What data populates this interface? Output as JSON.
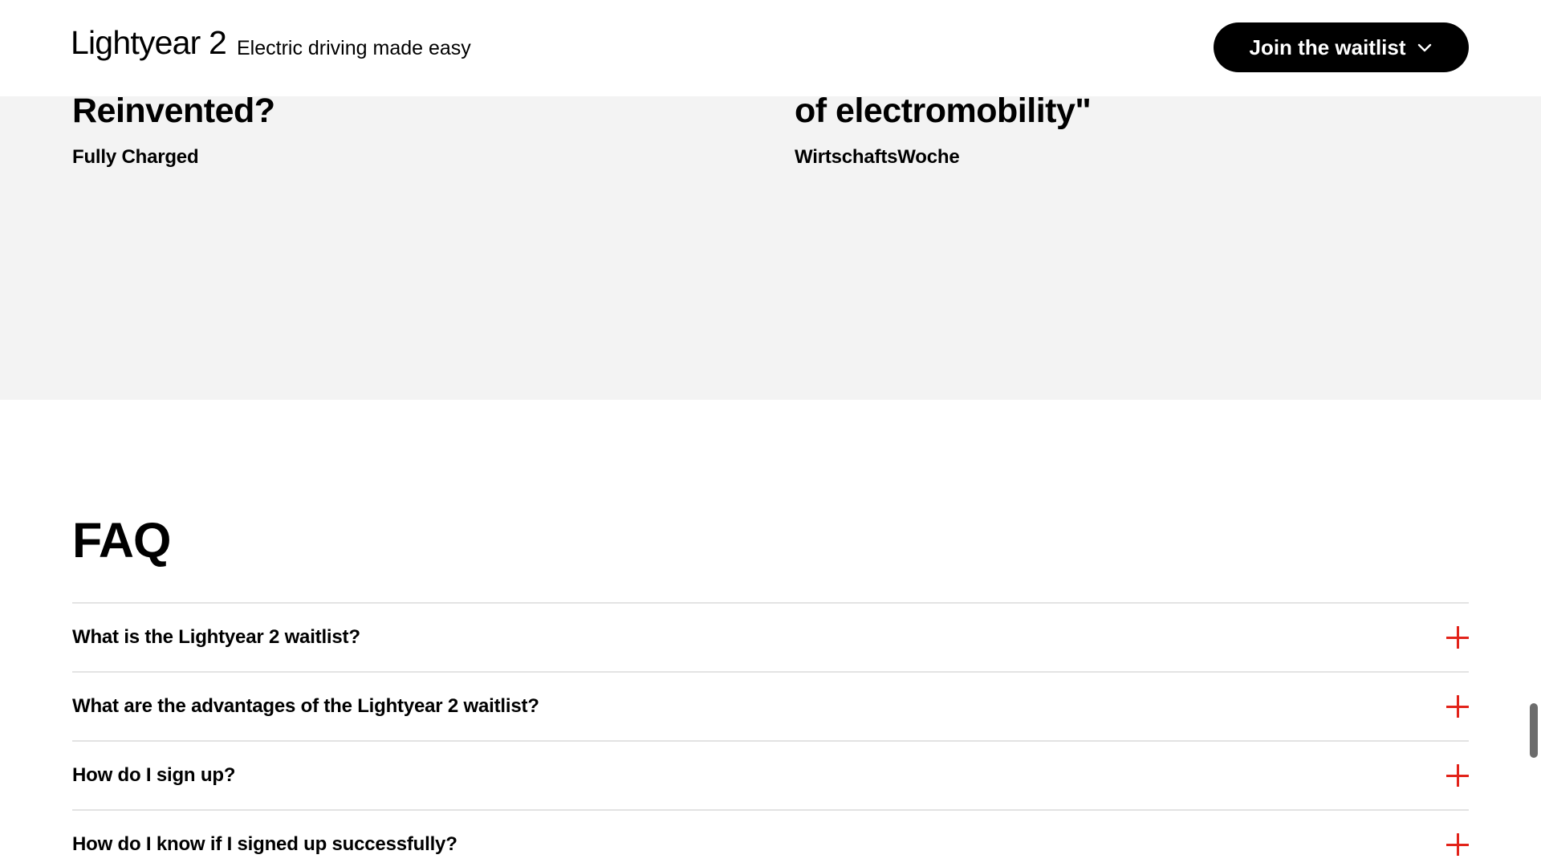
{
  "header": {
    "brand": "Lightyear 2",
    "tagline": "Electric driving made easy",
    "cta_label": "Join the waitlist"
  },
  "press": {
    "quotes": [
      {
        "title": "Reinvented?",
        "source": "Fully Charged"
      },
      {
        "title": "of electromobility\"",
        "source": "WirtschaftsWoche"
      }
    ]
  },
  "faq": {
    "title": "FAQ",
    "items": [
      {
        "question": "What is the Lightyear 2 waitlist?"
      },
      {
        "question": "What are the advantages of the Lightyear 2 waitlist?"
      },
      {
        "question": "How do I sign up?"
      },
      {
        "question": "How do I know if I signed up successfully?"
      }
    ]
  },
  "colors": {
    "accent": "#e2231a",
    "cta_background": "#000000",
    "press_background": "#f3f3f3",
    "divider": "#e3e3e3"
  },
  "icons": {
    "cta": "chevron-down-icon",
    "faq_expand": "plus-icon"
  }
}
